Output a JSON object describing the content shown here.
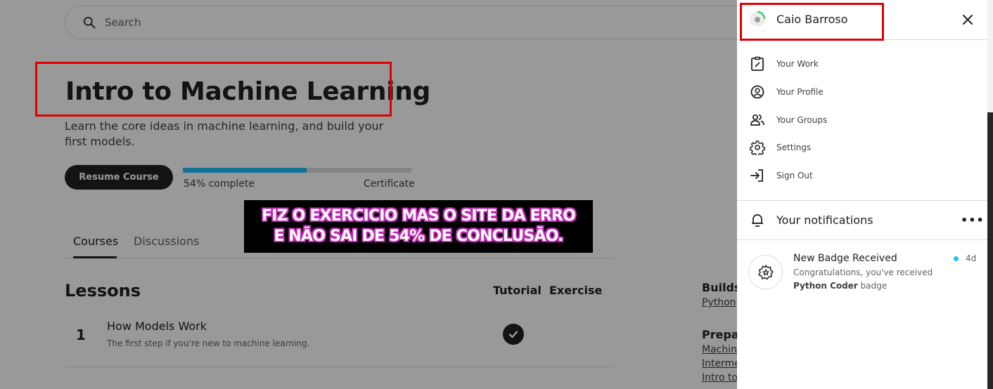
{
  "search": {
    "placeholder": "Search"
  },
  "course": {
    "title": "Intro to Machine Learning",
    "subtitle": "Learn the core ideas in machine learning, and build your first models.",
    "resume_label": "Resume Course",
    "progress_text": "54% complete",
    "progress_fraction": 0.54,
    "certificate_label": "Certificate"
  },
  "tabs": [
    {
      "label": "Courses",
      "active": true
    },
    {
      "label": "Discussions",
      "active": false
    }
  ],
  "lessons": {
    "heading": "Lessons",
    "columns": [
      "Tutorial",
      "Exercise"
    ],
    "rows": [
      {
        "number": "1",
        "title": "How Models Work",
        "description": "The first step if you're new to machine learning.",
        "tutorial_done": true
      }
    ]
  },
  "sidebar_right": {
    "builds_heading": "Builds",
    "builds_link": "Python",
    "prep_heading": "Prepar",
    "prep_links": [
      "Machin",
      "Interme",
      "Intro to"
    ]
  },
  "annotation": {
    "line1": "FIZ O EXERCICIO MAS O SITE DA ERRO",
    "line2": "E NÃO SAI DE 54% DE CONCLUSÃO."
  },
  "drawer": {
    "user_name": "Caio Barroso",
    "menu": [
      {
        "label": "Your Work",
        "icon": "assignment-icon"
      },
      {
        "label": "Your Profile",
        "icon": "profile-icon"
      },
      {
        "label": "Your Groups",
        "icon": "groups-icon"
      },
      {
        "label": "Settings",
        "icon": "gear-icon"
      },
      {
        "label": "Sign Out",
        "icon": "sign-out-icon"
      }
    ],
    "notifications_heading": "Your notifications",
    "notification": {
      "title": "New Badge Received",
      "body": "Congratulations, you've received",
      "badge_name": "Python Coder",
      "badge_suffix": "badge",
      "time": "4d"
    }
  },
  "colors": {
    "accent": "#20beff",
    "annotation_red": "#e00000",
    "banner_outline": "#c02bb6"
  }
}
